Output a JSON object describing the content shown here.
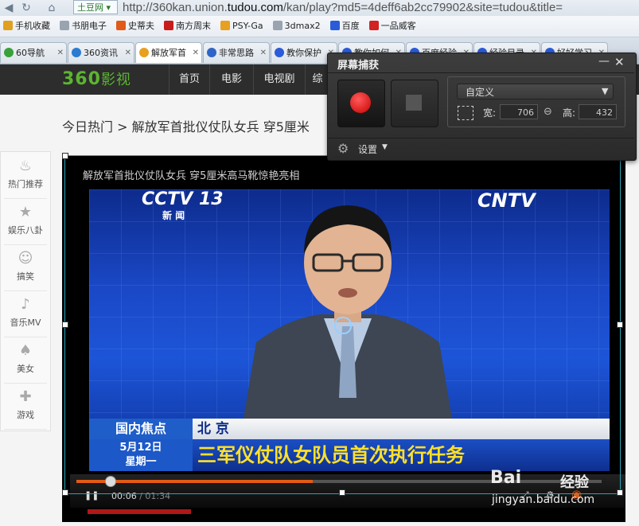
{
  "browser": {
    "site_dropdown": "土豆网",
    "url_prefix": "http://360kan.union.",
    "url_domain": "tudou.com",
    "url_suffix": "/kan/play?md5=4deff6ab2cc79902&site=tudou&title="
  },
  "bookmarks": [
    {
      "label": "手机收藏",
      "color": "#e0a020"
    },
    {
      "label": "书朋电子",
      "color": "#9aa4b0"
    },
    {
      "label": "史蒂夫",
      "color": "#e05a1a"
    },
    {
      "label": "南方周末",
      "color": "#c61c1c"
    },
    {
      "label": "PSY-Ga",
      "color": "#e8a020"
    },
    {
      "label": "3dmax2",
      "color": "#9aa4b0"
    },
    {
      "label": "百度",
      "color": "#2a5bd8"
    },
    {
      "label": "一品威客",
      "color": "#d22222"
    }
  ],
  "tabs": [
    {
      "label": "60导航",
      "active": false,
      "icon_color": "#3aa13a"
    },
    {
      "label": "360资讯",
      "active": false,
      "icon_color": "#2b7bd0"
    },
    {
      "label": "解放军首",
      "active": true,
      "icon_color": "#e8a020"
    },
    {
      "label": "非常思路",
      "active": false,
      "icon_color": "#2f65c8"
    },
    {
      "label": "教你保护",
      "active": false,
      "icon_color": "#2a5bd8"
    },
    {
      "label": "教你如何",
      "active": false,
      "icon_color": "#2a5bd8"
    },
    {
      "label": "百度经验",
      "active": false,
      "icon_color": "#2a5bd8"
    },
    {
      "label": "经验目录",
      "active": false,
      "icon_color": "#2a5bd8"
    },
    {
      "label": "好好学习",
      "active": false,
      "icon_color": "#2a5bd8"
    }
  ],
  "site": {
    "logo": "360",
    "logo_suffix": "影视",
    "nav": [
      "首页",
      "电影",
      "电视剧",
      "综"
    ]
  },
  "breadcrumb": {
    "section": "今日热门",
    "separator": ">",
    "title": "解放军首批仪仗队女兵 穿5厘米"
  },
  "sidebar": [
    {
      "label": "热门推荐",
      "icon": "flame-icon",
      "glyph": "♨"
    },
    {
      "label": "娱乐八卦",
      "icon": "star-icon",
      "glyph": "★"
    },
    {
      "label": "搞笑",
      "icon": "smile-icon",
      "glyph": "☺"
    },
    {
      "label": "音乐MV",
      "icon": "music-note-icon",
      "glyph": "♪"
    },
    {
      "label": "美女",
      "icon": "high-heel-icon",
      "glyph": "♠"
    },
    {
      "label": "游戏",
      "icon": "gamepad-icon",
      "glyph": "✚"
    }
  ],
  "player": {
    "title": "解放军首批仪仗队女兵 穿5厘米高马靴惊艳亮相",
    "time_current": "00:06",
    "time_separator": "/",
    "time_total": "01:34",
    "progress_fraction": 0.45
  },
  "video_frame": {
    "channel_logo": "CCTV 13",
    "channel_name": "新 闻",
    "corner_logo": "CNTV",
    "program": "国内焦点",
    "city": "北 京",
    "date_line1": "5月12日",
    "date_line2": "星期一",
    "headline": "三军仪仗队女队员首次执行任务"
  },
  "capture_window": {
    "title": "屏幕捕获",
    "minimize_glyph": "—",
    "close_glyph": "✕",
    "preset": "自定义",
    "width_label": "宽:",
    "width_value": "706",
    "height_label": "高:",
    "height_value": "432",
    "settings_label": "设置"
  },
  "watermark": {
    "logo": "Bai",
    "logo_cn": "经验",
    "url": "jingyan.baidu.com"
  }
}
